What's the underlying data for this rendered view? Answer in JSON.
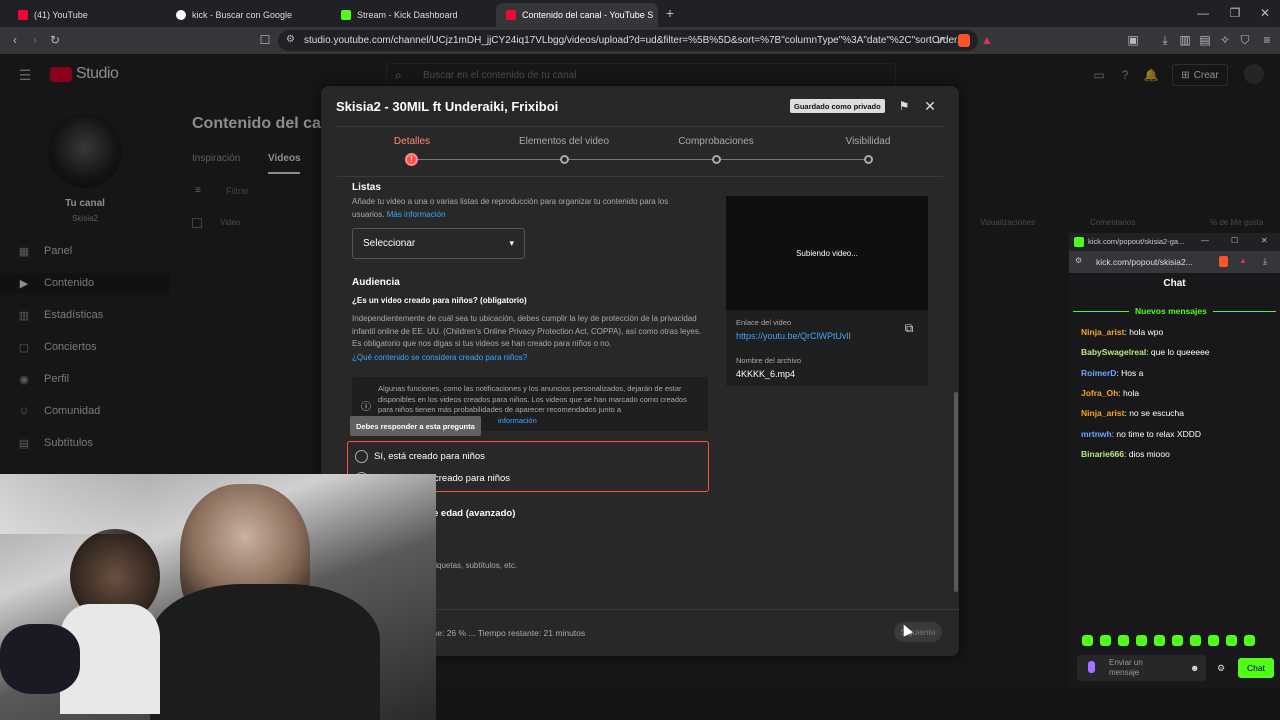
{
  "browser": {
    "tabs": [
      {
        "title": "(41) YouTube",
        "color": "#ff0033"
      },
      {
        "title": "kick - Buscar con Google",
        "color": "#ffffff"
      },
      {
        "title": "Stream - Kick Dashboard",
        "color": "#53fc18"
      },
      {
        "title": "Contenido del canal - YouTube S",
        "color": "#ff0033"
      }
    ],
    "url": "studio.youtube.com/channel/UCjz1mDH_jjCY24iq17VLbgg/videos/upload?d=ud&filter=%5B%5D&sort=%7B\"columnType\"%3A\"date\"%2C\"sortOrder..."
  },
  "studio": {
    "logo": "Studio",
    "search_placeholder": "Buscar en el contenido de tu canal",
    "create": "Crear",
    "channel_name": "Tu canal",
    "channel_handle": "Skisia2",
    "page_title": "Contenido del canal",
    "tabs": [
      "Inspiración",
      "Videos"
    ],
    "filter": "Filtrar",
    "col_video": "Video",
    "col_views": "Visualizaciones",
    "col_comments": "Comentarios",
    "col_likes": "% de Me gusta",
    "nav": [
      {
        "label": "Panel",
        "icon": "dashboard-icon"
      },
      {
        "label": "Contenido",
        "icon": "content-icon"
      },
      {
        "label": "Estadísticas",
        "icon": "analytics-icon"
      },
      {
        "label": "Conciertos",
        "icon": "concert-icon"
      },
      {
        "label": "Perfil",
        "icon": "profile-icon"
      },
      {
        "label": "Comunidad",
        "icon": "community-icon"
      },
      {
        "label": "Subtítulos",
        "icon": "subtitles-icon"
      }
    ]
  },
  "dialog": {
    "title": "Skisia2 - 30MIL ft Underaiki, Frixiboi",
    "saved_badge": "Guardado como privado",
    "steps": [
      "Detalles",
      "Elementos del video",
      "Comprobaciones",
      "Visibilidad"
    ],
    "playlists_heading": "Listas",
    "playlists_text": "Añade tu video a una o varias listas de reproducción para organizar tu contenido para los usuarios.",
    "more_info": "Más información",
    "select_label": "Seleccionar",
    "audience_heading": "Audiencia",
    "audience_question": "¿Es un video creado para niños? (obligatorio)",
    "audience_text": "Independientemente de cuál sea tu ubicación, debes cumplir la ley de protección de la privacidad infantil online de EE. UU. (Children's Online Privacy Protection Act, COPPA), así como otras leyes. Es obligatorio que nos digas si tus videos se han creado para niños o no.",
    "audience_link": "¿Qué contenido se considera creado para niños?",
    "info_text": "Algunas funciones, como las notificaciones y los anuncios personalizados, dejarán de estar disponibles en los videos creados para niños. Los videos que se han marcado como creados para niños tienen más probabilidades de aparecer recomendados junto a",
    "info_link": "información",
    "tooltip": "Debes responder a esta pregunta",
    "option_yes": "Sí, está creado para niños",
    "option_no": "creado para niños",
    "age_restriction": "e edad (avanzado)",
    "more_options": "tiquetas, subtítulos, etc.",
    "preview_status": "Subiendo video...",
    "video_link_label": "Enlace del video",
    "video_link": "https://youtu.be/QrClWPtUvlI",
    "filename_label": "Nombre del archivo",
    "filename": "4KKKK_6.mp4",
    "progress_text": "se: 26 % ... Tiempo restante: 21 minutos",
    "progress_percent": 26,
    "next_button": "Siguiente"
  },
  "chat": {
    "url": "kick.com/popout/skisia2-ga...",
    "url2": "kick.com/popout/skisia2...",
    "title": "Chat",
    "new_messages": "Nuevos mensajes",
    "messages": [
      {
        "user": "Ninja_arist",
        "text": ": hola wpo",
        "color": "#f5a623"
      },
      {
        "user": "BabySwagelreal",
        "text": ": que lo queeeee",
        "color": "#b8e986"
      },
      {
        "user": "RoimerD",
        "text": ": Hos a",
        "color": "#6aa8ff"
      },
      {
        "user": "Jofra_Oh",
        "text": ": hola",
        "color": "#f5a623"
      },
      {
        "user": "Ninja_arist",
        "text": ": no se escucha",
        "color": "#f5a623"
      },
      {
        "user": "mrtnwh",
        "text": ": no time to relax XDDD",
        "color": "#6aa8ff"
      },
      {
        "user": "Binarie666",
        "text": ": dios miooo",
        "color": "#b8e986"
      }
    ],
    "input_placeholder": "Enviar un mensaje",
    "send_button": "Chat",
    "accent": "#53fc18"
  }
}
